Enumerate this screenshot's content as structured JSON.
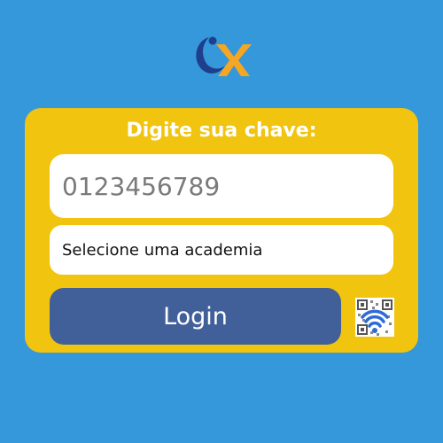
{
  "header": {
    "logo_icon": "brand-logo-icon",
    "colors": {
      "primary_blue": "#1f3e8c",
      "accent_yellow": "#f1c40f"
    }
  },
  "login_card": {
    "title": "Digite sua chave:",
    "key_input": {
      "value": "",
      "placeholder": "0123456789"
    },
    "gym_select": {
      "label": "Selecione uma academia"
    },
    "login_button": {
      "label": "Login"
    },
    "qr_wifi_button": {
      "icon": "qr-wifi-icon"
    }
  },
  "colors": {
    "background": "#3498db",
    "card": "#f1c40f",
    "button": "#41609a"
  }
}
